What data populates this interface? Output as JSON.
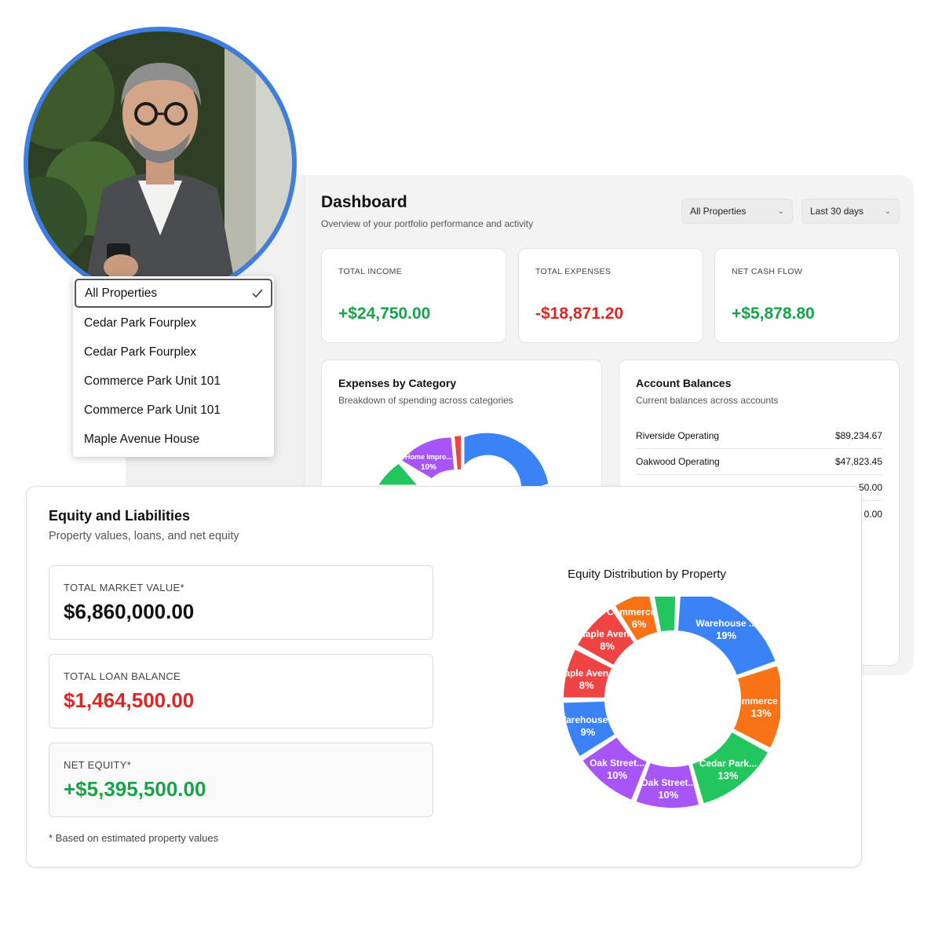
{
  "dashboard": {
    "title": "Dashboard",
    "subtitle": "Overview of your portfolio performance and activity",
    "filters": {
      "property": "All Properties",
      "range": "Last 30 days"
    },
    "stats": [
      {
        "label": "TOTAL INCOME",
        "value": "+$24,750.00"
      },
      {
        "label": "TOTAL EXPENSES",
        "value": "-$18,871.20"
      },
      {
        "label": "NET CASH FLOW",
        "value": "+$5,878.80"
      }
    ],
    "expenses": {
      "title": "Expenses by Category",
      "subtitle": "Breakdown of spending across categories",
      "visible_slice": {
        "label": "Home Impro...",
        "percent": "10%"
      }
    },
    "accounts": {
      "title": "Account Balances",
      "subtitle": "Current balances across accounts",
      "rows": [
        {
          "name": "Riverside Operating",
          "balance": "$89,234.67"
        },
        {
          "name": "Oakwood Operating",
          "balance": "$47,823.45"
        },
        {
          "name": "",
          "balance": "50.00"
        },
        {
          "name": "",
          "balance": "0.00"
        }
      ]
    }
  },
  "dropdown": {
    "items": [
      {
        "label": "All Properties",
        "selected": true
      },
      {
        "label": "Cedar Park Fourplex"
      },
      {
        "label": "Cedar Park Fourplex"
      },
      {
        "label": "Commerce Park Unit 101"
      },
      {
        "label": "Commerce Park Unit 101"
      },
      {
        "label": "Maple Avenue House"
      }
    ]
  },
  "equity": {
    "title": "Equity and Liabilities",
    "subtitle": "Property values, loans, and net equity",
    "market": {
      "label": "TOTAL MARKET VALUE*",
      "value": "$6,860,000.00"
    },
    "loan": {
      "label": "TOTAL LOAN BALANCE",
      "value": "$1,464,500.00"
    },
    "net": {
      "label": "NET EQUITY*",
      "value": "+$5,395,500.00"
    },
    "footnote": "* Based on estimated property values"
  },
  "chart_data": {
    "type": "pie",
    "title": "Equity Distribution by Property",
    "donut": true,
    "slices": [
      {
        "label": "Warehouse ...",
        "value": 19,
        "pct_label": "19%",
        "color": "#3b82f6"
      },
      {
        "label": "Commerce P...",
        "value": 13,
        "pct_label": "13%",
        "color": "#f97316"
      },
      {
        "label": "Cedar Park...",
        "value": 13,
        "pct_label": "13%",
        "color": "#22c55e"
      },
      {
        "label": "Oak Street...",
        "value": 10,
        "pct_label": "10%",
        "color": "#a855f7"
      },
      {
        "label": "Oak Street...",
        "value": 10,
        "pct_label": "10%",
        "color": "#a855f7"
      },
      {
        "label": "Warehouse ...",
        "value": 9,
        "pct_label": "9%",
        "color": "#3b82f6"
      },
      {
        "label": "Maple Aven...",
        "value": 8,
        "pct_label": "8%",
        "color": "#ef4444"
      },
      {
        "label": "Maple Aven...",
        "value": 8,
        "pct_label": "8%",
        "color": "#ef4444"
      },
      {
        "label": "Commerce P...",
        "value": 6,
        "pct_label": "6%",
        "color": "#f97316"
      },
      {
        "label": "",
        "value": 4,
        "pct_label": "",
        "color": "#22c55e"
      }
    ]
  }
}
